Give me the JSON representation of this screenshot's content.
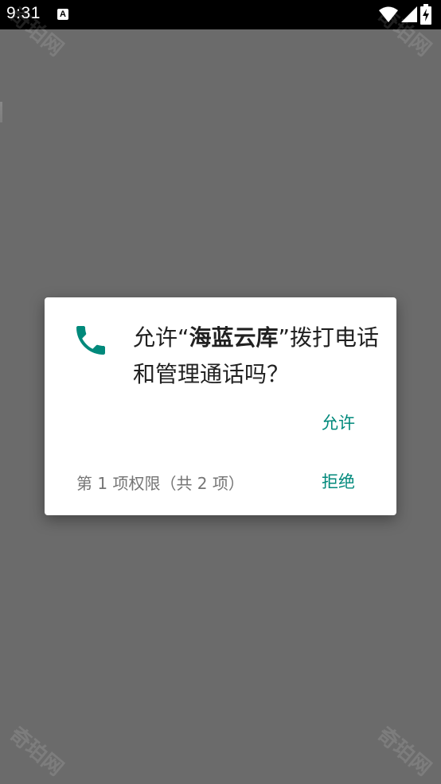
{
  "status_bar": {
    "time": "9:31",
    "notification_icon": "a-icon",
    "notification_glyph": "A",
    "icons": [
      "wifi-icon",
      "signal-icon",
      "battery-icon"
    ]
  },
  "watermark": {
    "text": "奇珀网"
  },
  "dialog": {
    "icon": "phone-icon",
    "icon_color": "#00897b",
    "title_prefix": "允许“",
    "app_name": "海蓝云库",
    "title_suffix": "”拨打电话和管理通话吗？",
    "allow_label": "允许",
    "counter_text": "第 1 项权限（共 2 项）",
    "deny_label": "拒绝",
    "accent_color": "#00897b"
  }
}
